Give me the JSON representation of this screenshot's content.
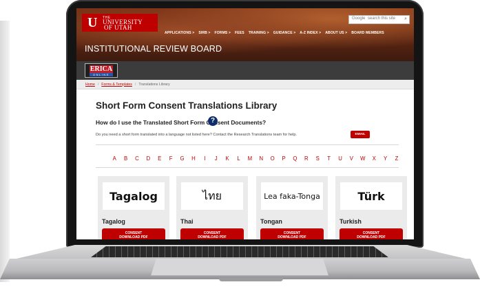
{
  "logo": {
    "the": "THE",
    "university": "UNIVERSITY",
    "of_utah": "OF UTAH"
  },
  "search": {
    "google": "Google",
    "placeholder": "search this site"
  },
  "nav": [
    "APPLICATIONS >",
    "SIRB >",
    "FORMS >",
    "FEES",
    "TRAINING >",
    "GUIDANCE >",
    "A-Z INDEX >",
    "ABOUT US >",
    "BOARD MEMBERS"
  ],
  "site_title": "INSTITUTIONAL REVIEW BOARD",
  "erica": {
    "top": "ERICA",
    "bottom": "ONLINE"
  },
  "breadcrumb": {
    "home": "Home",
    "forms": "Forms & Templates",
    "current": "Translations Library"
  },
  "page": {
    "title": "Short Form Consent Translations Library",
    "question": "How do I use the Translated Short Form Consent Documents?",
    "request": "Do you need a short form translated into a language not listed here? Contact the Research Translations team for help.",
    "email_button": "EMAIL"
  },
  "alphabet": [
    "A",
    "B",
    "C",
    "D",
    "E",
    "F",
    "G",
    "H",
    "I",
    "J",
    "K",
    "L",
    "M",
    "N",
    "O",
    "P",
    "Q",
    "R",
    "S",
    "T",
    "U",
    "V",
    "W",
    "X",
    "Y",
    "Z"
  ],
  "cards": [
    {
      "native": "Tagalog",
      "label": "Tagalog",
      "btn1": "CONSENT",
      "btn2": "DOWNLOAD PDF"
    },
    {
      "native": "ไทย",
      "label": "Thai",
      "btn1": "CONSENT",
      "btn2": "DOWNLOAD PDF"
    },
    {
      "native": "Lea faka-Tonga",
      "label": "Tongan",
      "btn1": "CONSENT",
      "btn2": "DOWNLOAD PDF"
    },
    {
      "native": "Türk",
      "label": "Turkish",
      "btn1": "CONSENT",
      "btn2": "DOWNLOAD PDF"
    }
  ],
  "colors": {
    "brand_red": "#be0000",
    "help_blue": "#0f2d6b"
  }
}
